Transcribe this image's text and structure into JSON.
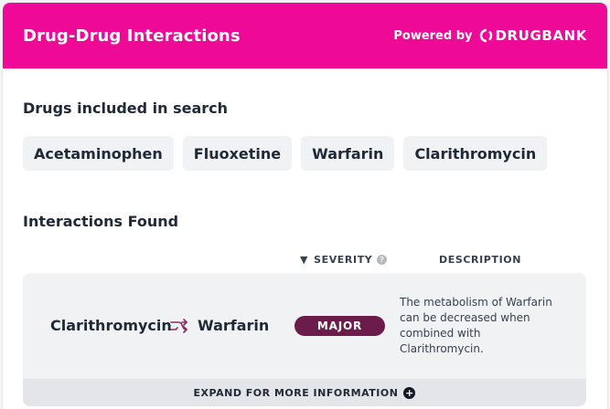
{
  "header": {
    "title": "Drug-Drug Interactions",
    "powered_by": "Powered by",
    "brand": "DRUGBANK"
  },
  "drugs_section": {
    "label": "Drugs included in search",
    "drugs": [
      "Acetaminophen",
      "Fluoxetine",
      "Warfarin",
      "Clarithromycin"
    ]
  },
  "interactions_section": {
    "label": "Interactions Found",
    "columns": {
      "severity": "SEVERITY",
      "description": "DESCRIPTION"
    },
    "interactions": [
      {
        "drug_a": "Clarithromycin",
        "drug_b": "Warfarin",
        "severity": "MAJOR",
        "description": "The metabolism of Warfarin can be decreased when combined with Clarithromycin."
      }
    ],
    "expand_label": "EXPAND FOR MORE INFORMATION"
  },
  "colors": {
    "header_bg": "#ee0a96",
    "severity_major": "#6b1c4a",
    "chip_bg": "#f1f2f4"
  },
  "icons": {
    "sort": "triangle-down-icon",
    "help": "question-circle-icon",
    "interaction": "swap-arrows-icon",
    "expand": "plus-circle-icon"
  }
}
